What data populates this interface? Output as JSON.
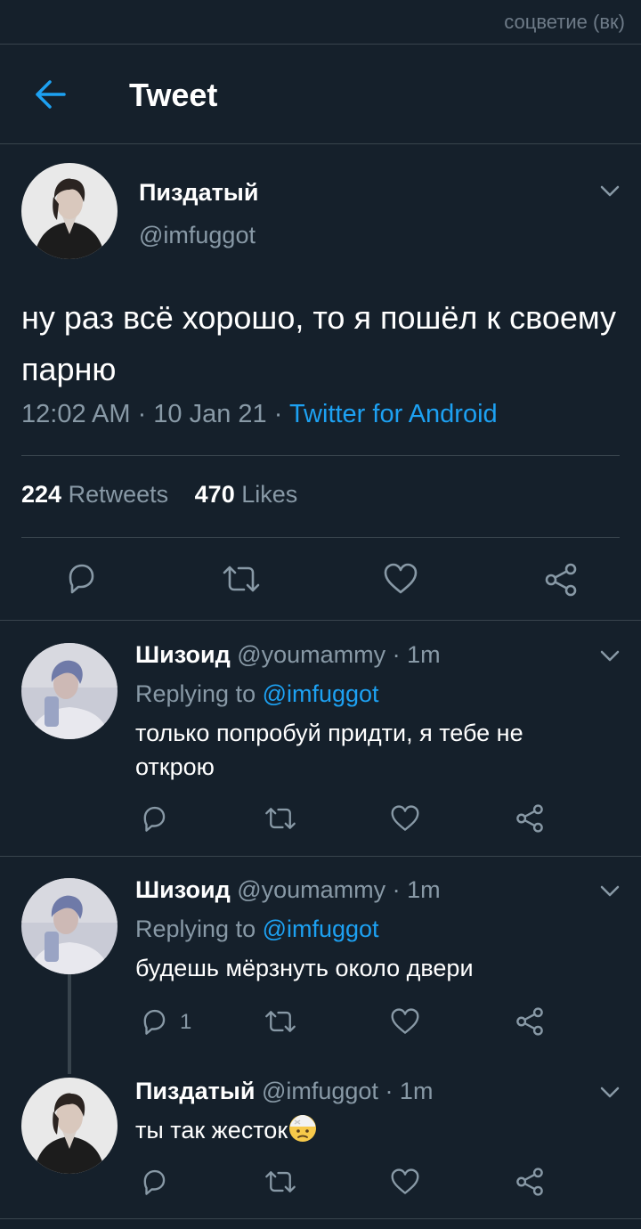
{
  "watermark": "соцветие (вк)",
  "header": {
    "title": "Tweet"
  },
  "main_tweet": {
    "name": "Пиздатый",
    "handle": "@imfuggot",
    "text": "ну раз всё хорошо, то я пошёл к своему парню",
    "time": "12:02 AM · 10 Jan 21 · ",
    "source": "Twitter for Android",
    "retweets_count": "224",
    "retweets_label": "Retweets",
    "likes_count": "470",
    "likes_label": "Likes"
  },
  "replies": [
    {
      "name": "Шизоид",
      "meta": " @youmammy · 1m",
      "replying_prefix": "Replying to ",
      "replying_to": "@imfuggot",
      "text": "только попробуй придти, я тебе не открою",
      "reply_count": ""
    },
    {
      "name": "Шизоид",
      "meta": " @youmammy · 1m",
      "replying_prefix": "Replying to ",
      "replying_to": "@imfuggot",
      "text": "будешь мёрзнуть около двери",
      "reply_count": "1"
    },
    {
      "name": "Пиздатый",
      "meta": " @imfuggot · 1m",
      "text": "ты так жесток",
      "emoji": "face-with-head-bandage-emoji"
    }
  ],
  "colors": {
    "background": "#15202b",
    "accent": "#1da1f2",
    "muted": "#8899a6",
    "divider": "#38444d"
  }
}
